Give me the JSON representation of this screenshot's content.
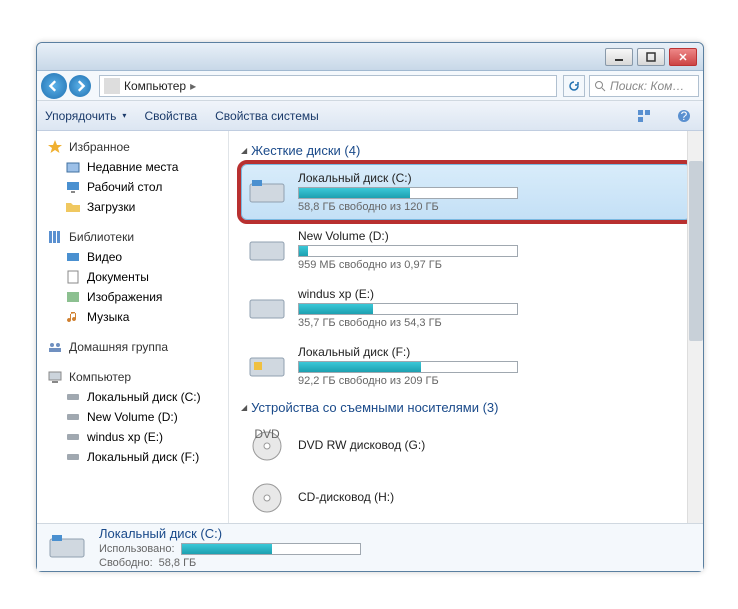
{
  "address": {
    "location": "Компьютер",
    "arrow": "▸"
  },
  "search": {
    "placeholder": "Поиск: Ком…"
  },
  "toolbar": {
    "organize": "Упорядочить",
    "properties": "Свойства",
    "system_properties": "Свойства системы"
  },
  "sidebar": {
    "favorites": {
      "label": "Избранное",
      "items": [
        "Недавние места",
        "Рабочий стол",
        "Загрузки"
      ]
    },
    "libraries": {
      "label": "Библиотеки",
      "items": [
        "Видео",
        "Документы",
        "Изображения",
        "Музыка"
      ]
    },
    "homegroup": {
      "label": "Домашняя группа"
    },
    "computer": {
      "label": "Компьютер",
      "items": [
        "Локальный диск (C:)",
        "New Volume (D:)",
        "windus xp (E:)",
        "Локальный диск (F:)"
      ]
    }
  },
  "content": {
    "hdd_group": "Жесткие диски (4)",
    "removable_group": "Устройства со съемными носителями (3)",
    "drives": [
      {
        "name": "Локальный диск (C:)",
        "info": "58,8 ГБ свободно из 120 ГБ",
        "fill": 51,
        "selected": true
      },
      {
        "name": "New Volume (D:)",
        "info": "959 МБ свободно из 0,97 ГБ",
        "fill": 4
      },
      {
        "name": "windus xp (E:)",
        "info": "35,7 ГБ свободно из 54,3 ГБ",
        "fill": 34
      },
      {
        "name": "Локальный диск (F:)",
        "info": "92,2 ГБ свободно из 209 ГБ",
        "fill": 56
      }
    ],
    "removable": [
      {
        "name": "DVD RW дисковод (G:)"
      },
      {
        "name": "CD-дисковод (H:)"
      }
    ]
  },
  "status": {
    "title": "Локальный диск (C:)",
    "used_label": "Использовано:",
    "free_label": "Свободно:",
    "free_value": "58,8 ГБ",
    "fill": 51
  }
}
